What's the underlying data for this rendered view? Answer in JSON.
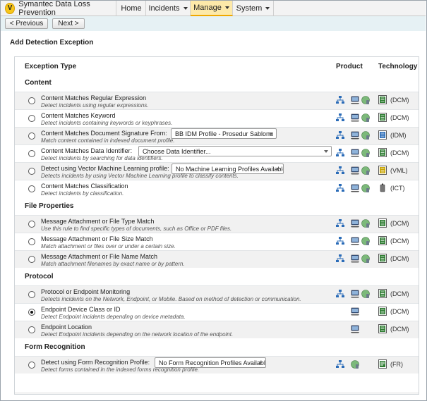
{
  "app": {
    "name": "Symantec Data Loss Prevention",
    "logo_letter": "V"
  },
  "nav": [
    {
      "label": "Home",
      "has_menu": false,
      "active": false
    },
    {
      "label": "Incidents",
      "has_menu": true,
      "active": false
    },
    {
      "label": "Manage",
      "has_menu": true,
      "active": true
    },
    {
      "label": "System",
      "has_menu": true,
      "active": false
    }
  ],
  "toolbar": {
    "previous_label": "< Previous",
    "next_label": "Next >"
  },
  "page": {
    "title": "Add Detection Exception"
  },
  "table": {
    "col_type": "Exception Type",
    "col_product": "Product",
    "col_technology": "Technology"
  },
  "sections": [
    {
      "title": "Content",
      "rows": [
        {
          "title": "Content Matches Regular Expression",
          "desc": "Detect incidents using regular expressions.",
          "products": [
            "network",
            "endpoint",
            "mobile"
          ],
          "tech": "(DCM)",
          "tech_icon": "dcm"
        },
        {
          "title": "Content Matches Keyword",
          "desc": "Detect incidents containing keywords or keyphrases.",
          "products": [
            "network",
            "endpoint",
            "mobile"
          ],
          "tech": "(DCM)",
          "tech_icon": "dcm"
        },
        {
          "title": "Content Matches Document Signature From:",
          "desc": "Match content contained in indexed document profile.",
          "select": "BB IDM Profile - Prosedur Sablonu",
          "products": [
            "network",
            "endpoint",
            "mobile"
          ],
          "tech": "(IDM)",
          "tech_icon": "idm"
        },
        {
          "title": "Content Matches Data Identifier:",
          "desc": "Detect incidents by searching for data identifiers.",
          "select": "Choose Data Identifier...",
          "products": [
            "network",
            "endpoint",
            "mobile"
          ],
          "tech": "(DCM)",
          "tech_icon": "dcm"
        },
        {
          "title": "Detect using Vector Machine Learning profile:",
          "desc": "Detects incidents by using Vector Machine Learning profile to classify contents.",
          "select": "No Machine Learning Profiles Available",
          "products": [
            "network",
            "endpoint",
            "mobile"
          ],
          "tech": "(VML)",
          "tech_icon": "vml"
        },
        {
          "title": "Content Matches Classification",
          "desc": "Detect incidents by classification.",
          "products": [
            "network",
            "endpoint",
            "mobile"
          ],
          "tech": "(ICT)",
          "tech_icon": "ict"
        }
      ]
    },
    {
      "title": "File Properties",
      "rows": [
        {
          "title": "Message Attachment or File Type Match",
          "desc": "Use this rule to find specific types of documents, such as Office or PDF files.",
          "products": [
            "network",
            "endpoint",
            "mobile"
          ],
          "tech": "(DCM)",
          "tech_icon": "dcm"
        },
        {
          "title": "Message Attachment or File Size Match",
          "desc": "Match attachment or files over or under a certain size.",
          "products": [
            "network",
            "endpoint",
            "mobile"
          ],
          "tech": "(DCM)",
          "tech_icon": "dcm"
        },
        {
          "title": "Message Attachment or File Name Match",
          "desc": "Match attachment filenames by exact name or by pattern.",
          "products": [
            "network",
            "endpoint",
            "mobile"
          ],
          "tech": "(DCM)",
          "tech_icon": "dcm"
        }
      ]
    },
    {
      "title": "Protocol",
      "rows": [
        {
          "title": "Protocol or Endpoint Monitoring",
          "desc": "Detects incidents on the Network, Endpoint, or Mobile. Based on method of detection or communication.",
          "products": [
            "network",
            "endpoint",
            "mobile"
          ],
          "tech": "(DCM)",
          "tech_icon": "dcm"
        },
        {
          "title": "Endpoint Device Class or ID",
          "desc": "Detect Endpoint incidents depending on device metadata.",
          "products": [
            "endpoint"
          ],
          "tech": "(DCM)",
          "tech_icon": "dcm",
          "selected": true
        },
        {
          "title": "Endpoint Location",
          "desc": "Detect Endpoint incidents depending on the network location of the endpoint.",
          "products": [
            "endpoint"
          ],
          "tech": "(DCM)",
          "tech_icon": "dcm"
        }
      ]
    },
    {
      "title": "Form Recognition",
      "rows": [
        {
          "title": "Detect using Form Recognition Profile:",
          "desc": "Detect forms contained in the indexed forms recognition profile.",
          "select": "No Form Recognition Profiles Available",
          "products": [
            "network",
            "mobile"
          ],
          "tech": "(FR)",
          "tech_icon": "fr"
        }
      ]
    }
  ],
  "colors": {
    "accent_tab": "#fde9a9",
    "sub_bar": "#e6f1f4",
    "network_icon": "#2b6cb8",
    "dcm_icon": "#2e7d32"
  }
}
